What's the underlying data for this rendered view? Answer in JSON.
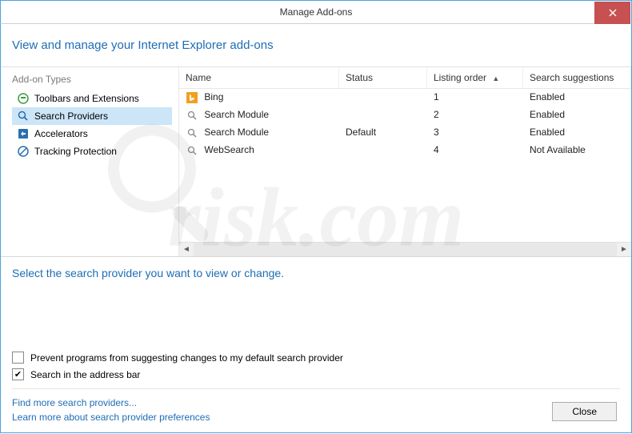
{
  "titlebar": {
    "title": "Manage Add-ons"
  },
  "header": {
    "text": "View and manage your Internet Explorer add-ons"
  },
  "sidebar": {
    "label": "Add-on Types",
    "items": [
      {
        "label": "Toolbars and Extensions"
      },
      {
        "label": "Search Providers"
      },
      {
        "label": "Accelerators"
      },
      {
        "label": "Tracking Protection"
      }
    ]
  },
  "table": {
    "columns": {
      "name": "Name",
      "status": "Status",
      "order": "Listing order",
      "suggest": "Search suggestions"
    },
    "rows": [
      {
        "name": "Bing",
        "status": "",
        "order": "1",
        "suggest": "Enabled"
      },
      {
        "name": "Search Module",
        "status": "",
        "order": "2",
        "suggest": "Enabled"
      },
      {
        "name": "Search Module",
        "status": "Default",
        "order": "3",
        "suggest": "Enabled"
      },
      {
        "name": "WebSearch",
        "status": "",
        "order": "4",
        "suggest": "Not Available"
      }
    ]
  },
  "lower": {
    "heading": "Select the search provider you want to view or change.",
    "checkbox1": "Prevent programs from suggesting changes to my default search provider",
    "checkbox2": "Search in the address bar"
  },
  "footer": {
    "link1": "Find more search providers...",
    "link2": "Learn more about search provider preferences",
    "close": "Close"
  },
  "watermark": "risk.com"
}
